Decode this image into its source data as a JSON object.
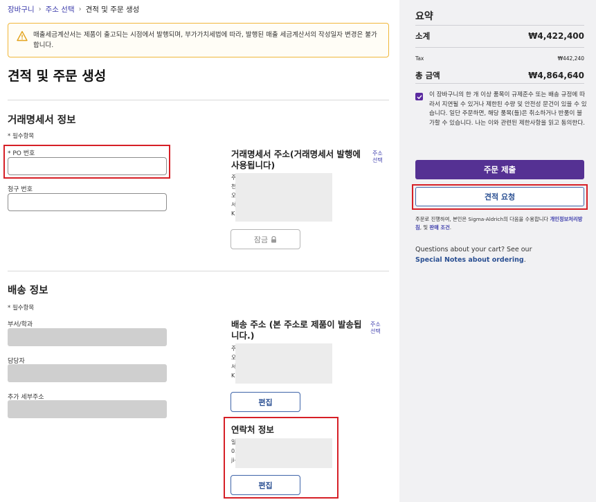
{
  "breadcrumb": {
    "items": [
      "장바구니",
      "주소 선택",
      "견적 및 주문 생성"
    ]
  },
  "warning": {
    "text": "매출세금계산서는 제품이 출고되는 시점에서 발행되며, 부가가치세법에 따라, 발행된 매출 세금계산서의 작성일자 변경은 불가합니다."
  },
  "page_title": "견적 및 주문 생성",
  "invoice": {
    "title": "거래명세서 정보",
    "required_note": "* 필수항목",
    "po_label": "* PO 번호",
    "po_value": "",
    "claim_label": "청구 번호",
    "claim_value": "",
    "address_title": "거래명세서 주소(거래명세서 발행에 사용됩니다)",
    "address_link": "주소 선택",
    "address_lines": [
      "주",
      "천",
      "오",
      "서",
      "K"
    ],
    "lock_button": "잠금"
  },
  "shipping": {
    "title": "배송 정보",
    "required_note": "* 필수항목",
    "dept_label": "부서/학과",
    "contact_label": "담당자",
    "extra_address_label": "추가 세부주소",
    "address_title": "배송 주소 (본 주소로 제품이 발송됩니다.)",
    "address_link": "주소선택",
    "address_lines": [
      "주",
      "오",
      "서",
      "K"
    ],
    "edit_button": "편집"
  },
  "contact": {
    "title": "연락처 정보",
    "lines": [
      "일",
      "03",
      "ji-"
    ],
    "edit_button": "편집"
  },
  "summary": {
    "title": "요약",
    "subtotal_label": "소계",
    "subtotal_value": "₩4,422,400",
    "tax_label": "Tax",
    "tax_value": "₩442,240",
    "total_label": "총 금액",
    "total_value": "₩4,864,640",
    "agree_text": "이 장바구니의 한 개 이상 품목이 규제준수 또는 배송 규정에 따라서 지연될 수 있거나 제한된 수량 및 안전성 문건이 있을 수 있습니다. 일단 주문하면, 해당 품목(들)은 취소하거나 반품이 불가할 수 있습니다. 나는 이와 관련된 제한사항을 읽고 동의한다.",
    "submit_button": "주문 제출",
    "quote_button": "견적 요청",
    "terms_prefix": "주문로 진행하여, 본인은 Sigma-Aldrich의 다음을 수용합니다 ",
    "terms_privacy": "개인정보처리방침",
    "terms_mid": ", 및 ",
    "terms_sale": "판매 조건",
    "terms_suffix": ".",
    "questions_text": "Questions about your cart? See our",
    "questions_link": "Special Notes about ordering",
    "questions_suffix": "."
  },
  "colors": {
    "accent": "#553193",
    "link": "#3d3dac",
    "highlight": "#d61f26",
    "warning_border": "#f0b73a"
  }
}
